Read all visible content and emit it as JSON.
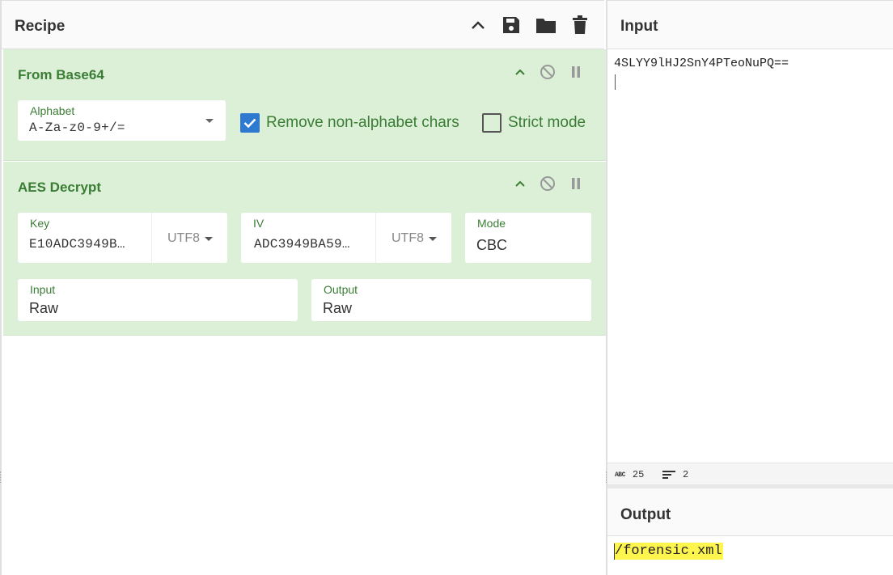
{
  "recipe": {
    "title": "Recipe",
    "header_icons": [
      "chevron-up-icon",
      "save-icon",
      "folder-icon",
      "trash-icon"
    ]
  },
  "from_base64": {
    "title": "From Base64",
    "alphabet_label": "Alphabet",
    "alphabet_value": "A-Za-z0-9+/=",
    "remove_non_alphabet_label": "Remove non-alphabet chars",
    "remove_non_alphabet_checked": true,
    "strict_mode_label": "Strict mode",
    "strict_mode_checked": false
  },
  "aes_decrypt": {
    "title": "AES Decrypt",
    "key_label": "Key",
    "key_value": "E10ADC3949B…",
    "key_encoding": "UTF8",
    "iv_label": "IV",
    "iv_value": "ADC3949BA59…",
    "iv_encoding": "UTF8",
    "mode_label": "Mode",
    "mode_value": "CBC",
    "input_label": "Input",
    "input_value": "Raw",
    "output_label": "Output",
    "output_value": "Raw"
  },
  "input_pane": {
    "title": "Input",
    "text": "4SLYY9lHJ2SnY4PTeoNuPQ==",
    "status_chars_icon": "ABC",
    "status_chars": "25",
    "status_lines": "2"
  },
  "output_pane": {
    "title": "Output",
    "text": "/forensic.xml"
  },
  "colors": {
    "operation_bg": "#dcf0d8",
    "operation_title": "#3a7d34",
    "checkbox_on": "#2e7ad1",
    "highlight": "#fef54e"
  }
}
